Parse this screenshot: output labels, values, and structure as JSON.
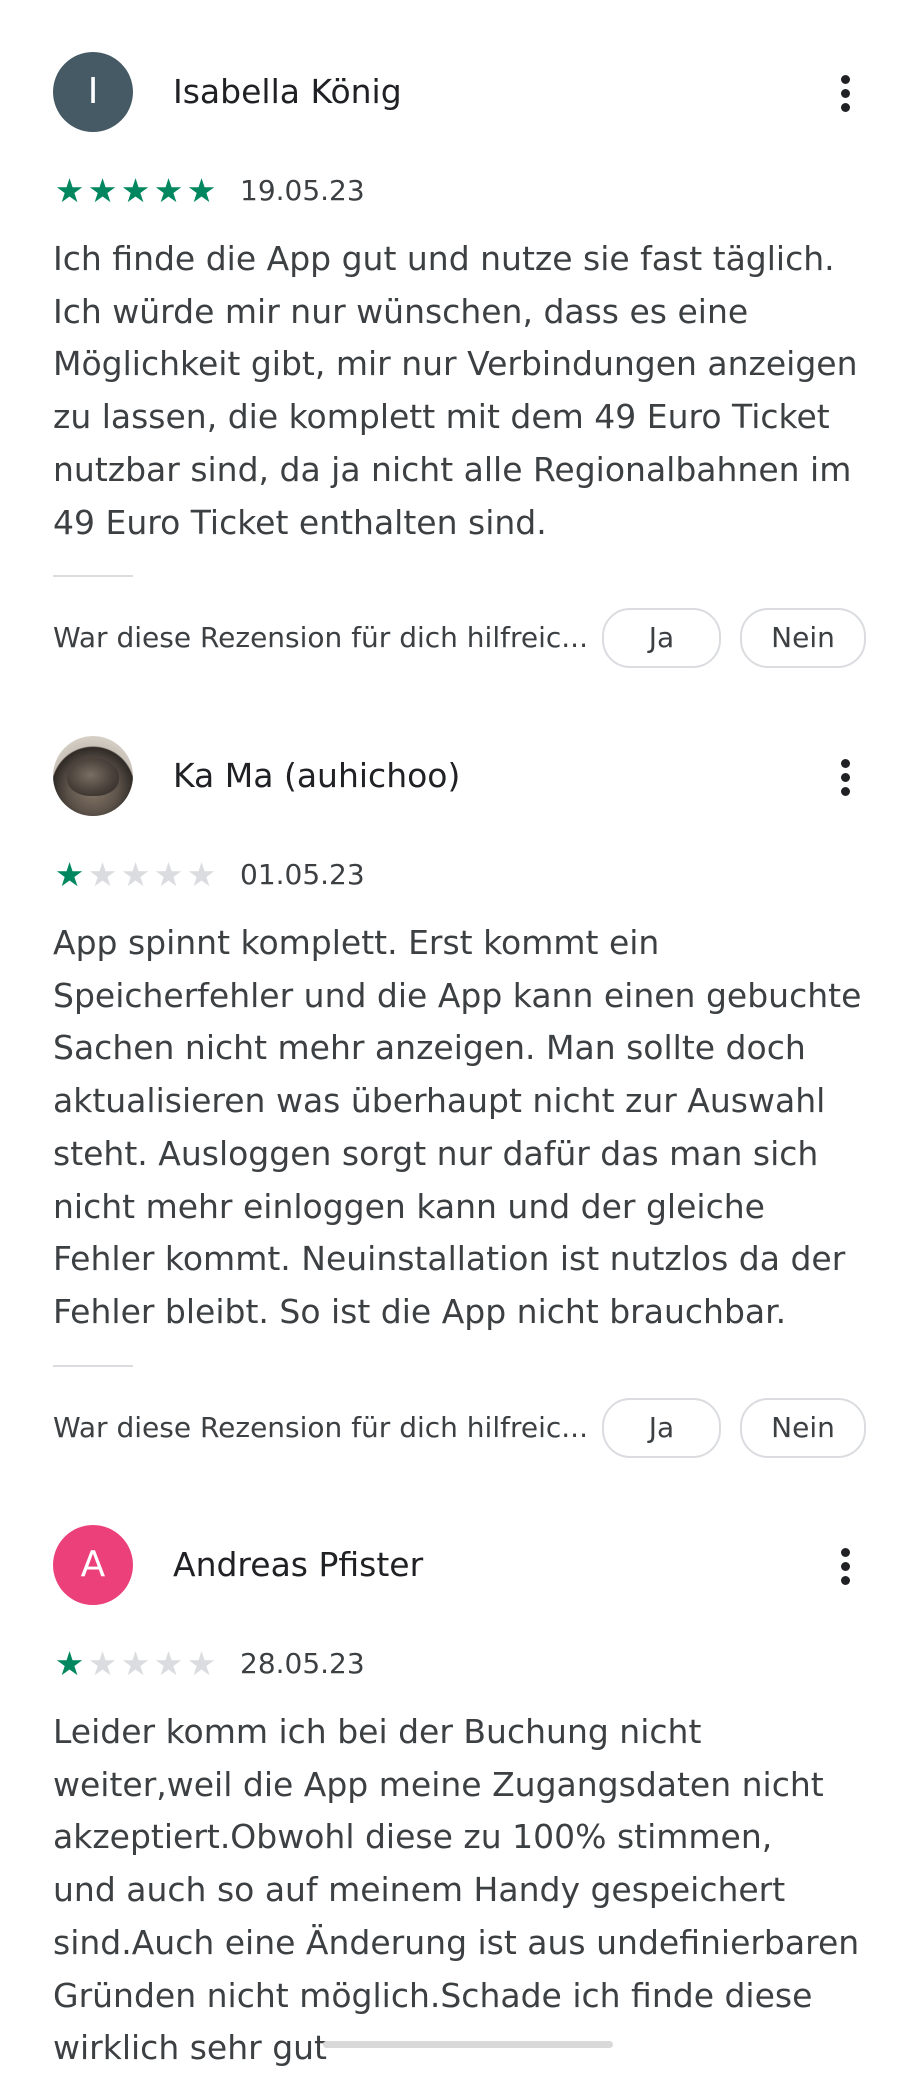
{
  "reviews": [
    {
      "name": "Isabella König",
      "avatar": {
        "initial": "I",
        "color": "#455a64"
      },
      "rating": 5,
      "date": "19.05.23",
      "text": "Ich finde die App gut und nutze sie fast täglich.\nIch würde mir nur wünschen, dass es eine\nMöglichkeit gibt, mir nur Verbindungen anzeigen\nzu lassen, die komplett mit dem 49 Euro Ticket\nnutzbar sind, da ja nicht alle Regionalbahnen im\n49 Euro Ticket enthalten sind.",
      "helpful_question": "War diese Rezension für dich hilfreic...",
      "yes_label": "Ja",
      "no_label": "Nein"
    },
    {
      "name": "Ka Ma (auhichoo)",
      "avatar": {
        "initial": "",
        "color": "#5d534a",
        "type": "photo-cat"
      },
      "rating": 1,
      "date": "01.05.23",
      "text": "App spinnt komplett. Erst kommt ein\nSpeicherfehler und die App kann einen gebuchte\nSachen nicht mehr anzeigen. Man sollte doch\naktualisieren was überhaupt nicht zur Auswahl\nsteht. Ausloggen sorgt nur dafür das man sich\nnicht mehr einloggen kann und der gleiche\nFehler kommt. Neuinstallation ist nutzlos da der\nFehler bleibt. So ist die App nicht brauchbar.",
      "helpful_question": "War diese Rezension für dich hilfreic...",
      "yes_label": "Ja",
      "no_label": "Nein"
    },
    {
      "name": "Andreas Pfister",
      "avatar": {
        "initial": "A",
        "color": "#ec407a"
      },
      "rating": 1,
      "date": "28.05.23",
      "text": "Leider komm ich bei der Buchung nicht\nweiter,weil die App meine Zugangsdaten nicht\nakzeptiert.Obwohl diese zu 100% stimmen,\nund auch so auf meinem Handy gespeichert\nsind.Auch eine Änderung ist aus undefinierbaren\nGründen nicht möglich.Schade ich finde diese\nwirklich sehr gut"
    }
  ],
  "star_max": 5,
  "colors": {
    "star_filled": "#01875f",
    "star_empty": "#dadce0",
    "text_primary": "#202124",
    "text_secondary": "#3c4043",
    "outline": "#dadce0"
  },
  "icons": {
    "more": "more-vert-icon",
    "star": "star-icon"
  }
}
